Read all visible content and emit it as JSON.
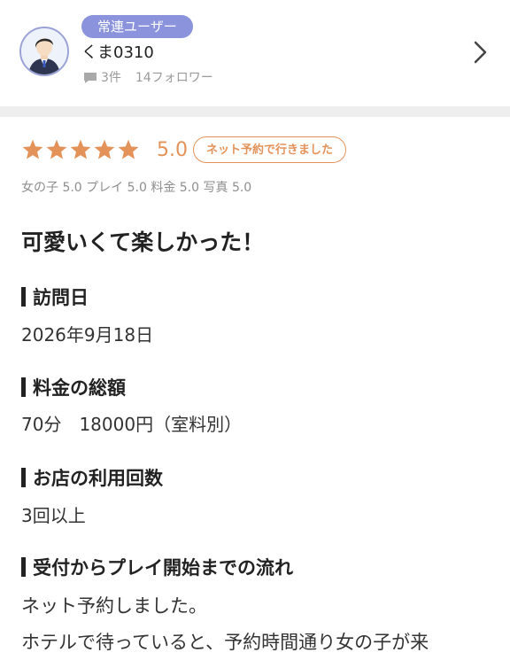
{
  "reviewer": {
    "badge": "常連ユーザー",
    "name": "くま0310",
    "review_count": "3件",
    "followers": "14フォロワー"
  },
  "rating": {
    "stars": 5,
    "score": "5.0",
    "reservation_badge": "ネット予約で行きました",
    "sub_ratings": "女の子 5.0  プレイ 5.0  料金 5.0  写真 5.0"
  },
  "review": {
    "title": "可愛いくて楽しかった！",
    "sections": [
      {
        "heading": "訪問日",
        "value": "2026年9月18日"
      },
      {
        "heading": "料金の総額",
        "value": "70分　18000円（室料別）"
      },
      {
        "heading": "お店の利用回数",
        "value": "3回以上"
      },
      {
        "heading": "受付からプレイ開始までの流れ"
      }
    ],
    "body": [
      "ネット予約しました。",
      "ホテルで待っていると、予約時間通り女の子が来"
    ]
  },
  "colors": {
    "accent_orange": "#e3935a",
    "badge_purple": "#8a93dc",
    "divider": "#eeeeee"
  },
  "icons": [
    "avatar",
    "comment-icon",
    "chevron-right-icon",
    "star-icon"
  ]
}
